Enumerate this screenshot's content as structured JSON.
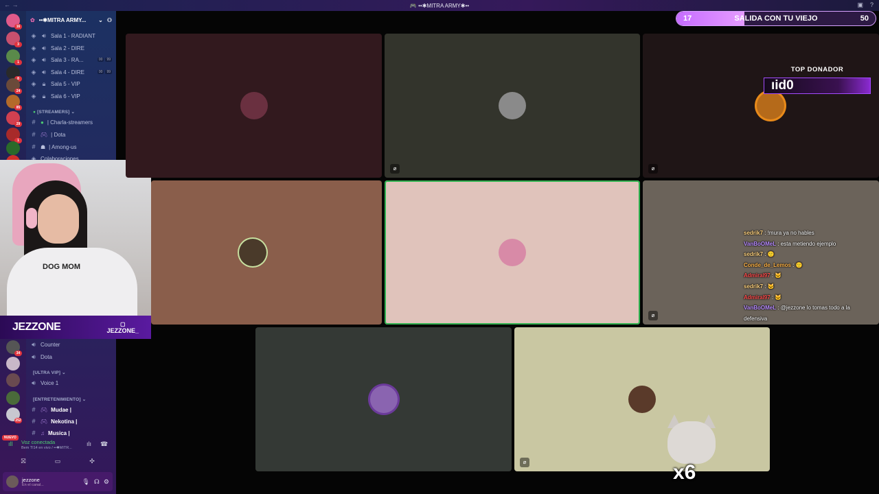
{
  "window": {
    "title": "🎮 ••✱MITRA ARMY✱••",
    "colors": {
      "accent": "#c66dff",
      "panel": "#461a6a",
      "green": "#4ecb72"
    }
  },
  "servers": [
    {
      "badge": "16"
    },
    {
      "badge": "3"
    },
    {
      "badge": "1"
    },
    {
      "badge": "8"
    },
    {
      "badge": "24"
    },
    {
      "badge": "85"
    },
    {
      "badge": "29"
    },
    {
      "badge": "1"
    },
    {
      "badge": "34"
    },
    {
      "badge": "252"
    }
  ],
  "server_new_label": "NUEVO",
  "guild": {
    "name": "••✱MITRA ARMY...",
    "invite_icon": "person-add-icon"
  },
  "voice_channels": [
    {
      "name": "Sala 1 - RADIANT",
      "tags": []
    },
    {
      "name": "Sala 2 - DIRE",
      "tags": []
    },
    {
      "name": "Sala 3 - RA...",
      "tags": [
        "00",
        "99"
      ]
    },
    {
      "name": "Sala 4 - DIRE",
      "tags": [
        "00",
        "99"
      ]
    },
    {
      "name": "Sala 5 - VIP",
      "tags": []
    },
    {
      "name": "Sala 6 - VIP",
      "tags": []
    }
  ],
  "categories": {
    "streamers": "[STREAMERS]",
    "ultra_vip": "[ULTRA VIP]",
    "entretenimiento": "[ENTRETENIMIENTO]"
  },
  "text_channels": [
    {
      "name": "| Charla-streamers"
    },
    {
      "name": "| Dota"
    },
    {
      "name": "| Among-us"
    },
    {
      "name": "Colaboraciones"
    }
  ],
  "lower_channels": [
    {
      "name": "Counter"
    },
    {
      "name": "Dota"
    },
    {
      "name": "Voice 1"
    },
    {
      "name": "Mudae |"
    },
    {
      "name": "Nekotina |"
    },
    {
      "name": "Musica |"
    }
  ],
  "webcam": {
    "brand": "JEZZONE",
    "handle": "JEZZONE_",
    "shirt_text": "DOG MOM"
  },
  "voice_status": {
    "title": "Voz conectada",
    "subtitle": "Bem TI14 en vivo / ••✱MITR..."
  },
  "user": {
    "name": "jezzone",
    "status": "En el canal..."
  },
  "goal": {
    "current": "17",
    "title": "SALIDA CON TU VIEJO",
    "target": "50",
    "progress": 0.34
  },
  "top_donor": {
    "label": "TOP DONADOR",
    "name": "ıid0"
  },
  "tiles": [
    {
      "color": "#32191e",
      "avatar": "#6a3040"
    },
    {
      "color": "#33342c",
      "avatar": "#8a8a8a"
    },
    {
      "color": "#1f1516",
      "avatar": "#b56a1a"
    },
    {
      "color": "#8a5e4b",
      "avatar": "#4a3a2a"
    },
    {
      "color": "#e0c3bb",
      "avatar": "#d88aa7"
    },
    {
      "color": "#6b635a",
      "avatar": "#555"
    },
    {
      "color": "#343935",
      "avatar": "#8a64b0"
    },
    {
      "color": "#c9c7a2",
      "avatar": "#5a3a2a"
    }
  ],
  "chat": [
    {
      "user": "sedrik7",
      "color": "#ffd27f",
      "msg": " : !mura ya no hables"
    },
    {
      "user": "VanBoOMeL",
      "color": "#b88cff",
      "msg": " : esta metiendo ejemplo"
    },
    {
      "user": "sedrik7",
      "color": "#ffd27f",
      "msg": " : 🙂"
    },
    {
      "user": "Conde_de_Lemos",
      "color": "#ffb347",
      "msg": " : 🙂"
    },
    {
      "user": "Admiral97",
      "color": "#ff4d4d",
      "msg": " : 🐱"
    },
    {
      "user": "sedrik7",
      "color": "#ffd27f",
      "msg": " : 🐱"
    },
    {
      "user": "Admiral97",
      "color": "#ff4d4d",
      "msg": " : 🐱"
    },
    {
      "user": "VanBoOMeL",
      "color": "#b88cff",
      "msg": " : @jezzone lo tomas todo a la defensiva"
    }
  ],
  "emote": {
    "multiplier": "x6"
  }
}
